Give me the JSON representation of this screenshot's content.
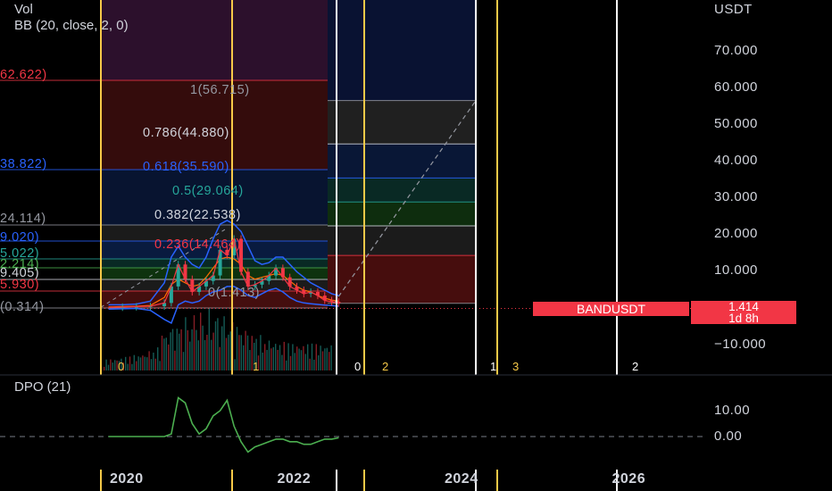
{
  "header": {
    "vol_label": "Vol",
    "bb_label": "BB (20, close, 2, 0)",
    "dpo_label": "DPO (21)"
  },
  "price_axis": {
    "currency": "USDT",
    "ticks": [
      "70.000",
      "60.000",
      "50.000",
      "40.000",
      "30.000",
      "20.000",
      "10.000",
      "0.000",
      "−10.000"
    ]
  },
  "dpo_axis": {
    "ticks": [
      "10.00",
      "0.00"
    ]
  },
  "time_axis": {
    "ticks": [
      "2020",
      "2022",
      "2024",
      "2026"
    ]
  },
  "fib_retracement": [
    {
      "level": "1",
      "price": "56.715",
      "label": "1(56.715)",
      "color": "#9598a1"
    },
    {
      "level": "0.786",
      "price": "44.880",
      "label": "0.786(44.880)",
      "color": "#d1d4dc"
    },
    {
      "level": "0.618",
      "price": "35.590",
      "label": "0.618(35.590)",
      "color": "#2962ff"
    },
    {
      "level": "0.5",
      "price": "29.064",
      "label": "0.5(29.064)",
      "color": "#26a69a"
    },
    {
      "level": "0.382",
      "price": "22.538",
      "label": "0.382(22.538)",
      "color": "#d1d4dc"
    },
    {
      "level": "0.236",
      "price": "14.464",
      "label": "0.236(14.464)",
      "color": "#f23645"
    },
    {
      "level": "0",
      "price": "1.413",
      "label": "0(1.413)",
      "color": "#9598a1"
    }
  ],
  "left_fib_partial": [
    {
      "text": "62.622)",
      "color": "#f23645"
    },
    {
      "text": "38.822)",
      "color": "#2962ff"
    },
    {
      "text": "24.114)",
      "color": "#9598a1"
    },
    {
      "text": "9.020)",
      "color": "#2962ff"
    },
    {
      "text": "5.022)",
      "color": "#26a69a"
    },
    {
      "text": "2.214)",
      "color": "#4caf50"
    },
    {
      "text": "9.405)",
      "color": "#d1d4dc"
    },
    {
      "text": "5.930)",
      "color": "#f23645"
    },
    {
      "text": "(0.314)",
      "color": "#9598a1"
    }
  ],
  "cycle_labels": [
    {
      "text": "0",
      "color": "#f7c948"
    },
    {
      "text": "1",
      "color": "#f7c948"
    },
    {
      "text": "0",
      "color": "#ffffff"
    },
    {
      "text": "2",
      "color": "#f7c948"
    },
    {
      "text": "1",
      "color": "#ffffff"
    },
    {
      "text": "3",
      "color": "#f7c948"
    },
    {
      "text": "2",
      "color": "#ffffff"
    }
  ],
  "ticker": {
    "symbol": "BANDUSDT",
    "price": "1.414",
    "countdown": "1d 8h",
    "color": "#f23645"
  },
  "chart_data": {
    "type": "line",
    "title": "BANDUSDT",
    "ylabel": "USDT",
    "ylim": [
      -10,
      80
    ],
    "price_close": {
      "x": [
        "2019-10",
        "2019-12",
        "2020-02",
        "2020-04",
        "2020-06",
        "2020-07",
        "2020-08",
        "2020-09",
        "2020-10",
        "2020-11",
        "2020-12",
        "2021-01",
        "2021-02",
        "2021-03",
        "2021-04",
        "2021-05",
        "2021-06",
        "2021-07",
        "2021-08",
        "2021-09",
        "2021-10",
        "2021-11",
        "2021-12",
        "2022-01",
        "2022-02",
        "2022-03",
        "2022-04",
        "2022-05",
        "2022-06",
        "2022-07"
      ],
      "values": [
        0.3,
        0.4,
        0.5,
        0.6,
        1.5,
        6.0,
        12.0,
        8.0,
        4.5,
        6.0,
        7.5,
        9.0,
        16.0,
        14.5,
        19.0,
        10.0,
        6.0,
        6.5,
        7.5,
        9.0,
        11.0,
        8.5,
        6.0,
        5.0,
        4.0,
        4.5,
        3.5,
        2.2,
        1.8,
        1.414
      ]
    },
    "bollinger_upper": [
      1.0,
      1.0,
      1.2,
      2.0,
      7.0,
      14.0,
      17.0,
      14.0,
      12.0,
      11.0,
      14.0,
      19.0,
      23.0,
      24.0,
      23.0,
      21.0,
      17.0,
      13.0,
      12.0,
      12.5,
      14.0,
      14.0,
      12.0,
      10.0,
      8.5,
      7.0,
      6.0,
      5.0,
      4.0,
      3.5
    ],
    "bollinger_basis": [
      0.4,
      0.5,
      0.6,
      0.8,
      3.0,
      6.5,
      8.0,
      7.0,
      6.0,
      6.5,
      8.5,
      11.0,
      13.5,
      14.0,
      13.5,
      12.0,
      9.0,
      8.0,
      8.5,
      9.0,
      9.5,
      9.0,
      7.5,
      6.0,
      5.0,
      4.5,
      3.5,
      2.8,
      2.3,
      2.0
    ],
    "bollinger_lower": [
      -0.2,
      -0.1,
      0.0,
      -0.5,
      -3.0,
      -4.0,
      1.0,
      2.0,
      1.5,
      2.0,
      3.5,
      4.5,
      5.0,
      6.0,
      6.0,
      5.0,
      3.5,
      3.0,
      4.0,
      5.0,
      5.5,
      4.5,
      3.0,
      2.0,
      1.5,
      1.3,
      1.1,
      0.9,
      0.8,
      0.6
    ],
    "dpo": {
      "ylim": [
        -5,
        15
      ],
      "values": [
        0,
        0,
        0,
        0,
        0,
        1,
        15,
        13,
        5,
        1,
        3,
        8,
        10,
        14,
        4,
        -2,
        -6,
        -4,
        -3,
        -2,
        -1,
        -1,
        -2,
        -2,
        -3,
        -3,
        -2,
        -1,
        -1,
        -0.5
      ]
    },
    "legend": "none",
    "grid": false
  }
}
